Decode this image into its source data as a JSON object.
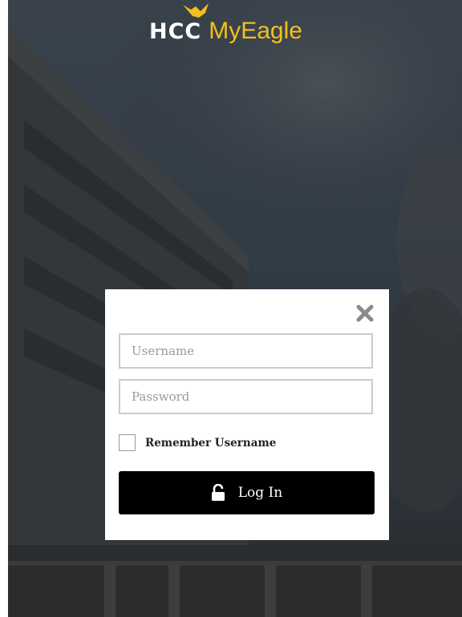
{
  "header": {
    "logo_hcc": "HCC",
    "logo_app": "MyEagle"
  },
  "login": {
    "username_placeholder": "Username",
    "password_placeholder": "Password",
    "remember_label": "Remember Username",
    "remember_checked": false,
    "login_label": "Log In",
    "close_icon": "close-icon",
    "lock_icon": "unlock-icon"
  },
  "colors": {
    "brand_gold": "#f2c11a",
    "button_bg": "#000000",
    "overlay": "#2e3236"
  }
}
